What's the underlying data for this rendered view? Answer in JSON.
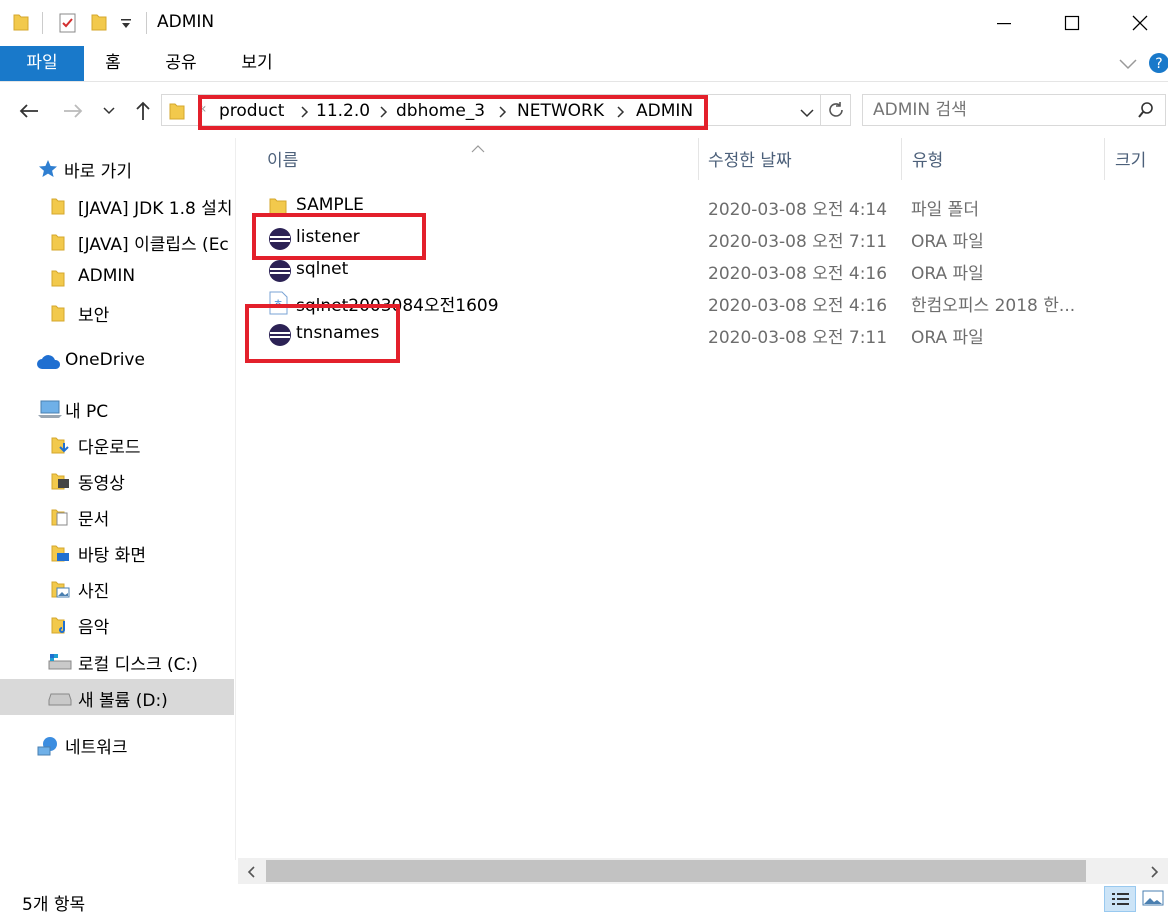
{
  "window": {
    "title": "ADMIN"
  },
  "ribbon": {
    "tabs": [
      "파일",
      "홈",
      "공유",
      "보기"
    ]
  },
  "address": {
    "crumbs": [
      "product",
      "11.2.0",
      "dbhome_3",
      "NETWORK",
      "ADMIN"
    ]
  },
  "search": {
    "placeholder": "ADMIN 검색"
  },
  "nav": {
    "quick_access": "바로 가기",
    "quick_items": [
      "[JAVA] JDK 1.8 설치",
      "[JAVA] 이클립스 (Ec",
      "ADMIN",
      "보안"
    ],
    "onedrive": "OneDrive",
    "this_pc": "내 PC",
    "pc_items": [
      "다운로드",
      "동영상",
      "문서",
      "바탕 화면",
      "사진",
      "음악",
      "로컬 디스크 (C:)",
      "새 볼륨 (D:)"
    ],
    "network": "네트워크"
  },
  "columns": {
    "name": "이름",
    "date": "수정한 날짜",
    "type": "유형",
    "size": "크기"
  },
  "files": [
    {
      "name": "SAMPLE",
      "date": "2020-03-08 오전 4:14",
      "type": "파일 폴더",
      "icon": "folder-icon"
    },
    {
      "name": "listener",
      "date": "2020-03-08 오전 7:11",
      "type": "ORA 파일",
      "icon": "eclipse-icon"
    },
    {
      "name": "sqlnet",
      "date": "2020-03-08 오전 4:16",
      "type": "ORA 파일",
      "icon": "eclipse-icon"
    },
    {
      "name": "sqlnet2003084오전1609",
      "date": "2020-03-08 오전 4:16",
      "type": "한컴오피스 2018 한...",
      "icon": "hwp-document-icon"
    },
    {
      "name": "tnsnames",
      "date": "2020-03-08 오전 7:11",
      "type": "ORA 파일",
      "icon": "eclipse-icon"
    }
  ],
  "status": {
    "item_count": "5개 항목"
  },
  "colors": {
    "accent": "#1979ca",
    "highlight_box": "#e3202b",
    "folder": "#f2c94c",
    "selected_nav": "#d9d9d9"
  }
}
